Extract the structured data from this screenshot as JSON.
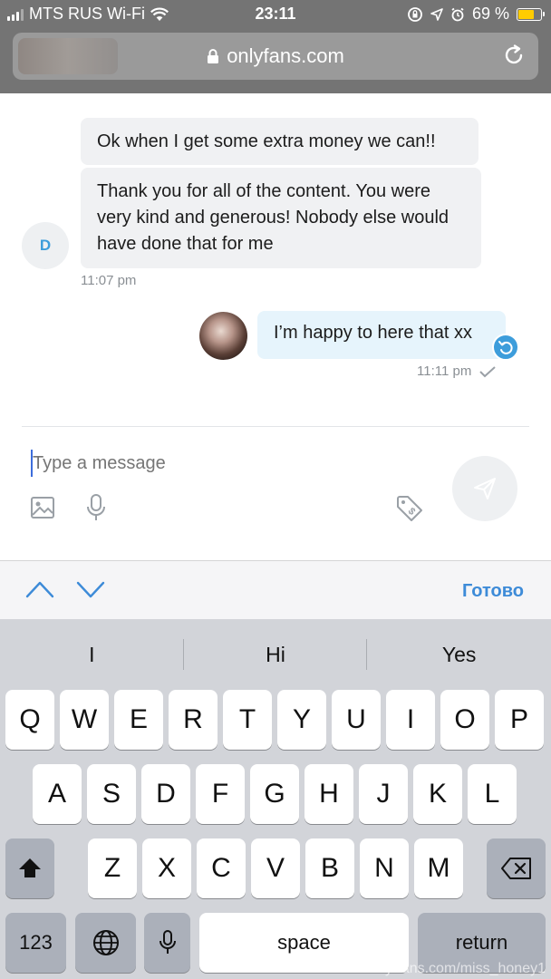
{
  "status_bar": {
    "carrier": "MTS RUS Wi-Fi",
    "time": "23:11",
    "battery_percent": "69 %"
  },
  "browser": {
    "url": "onlyfans.com"
  },
  "chat": {
    "contact_initial": "D",
    "messages": [
      {
        "text": "Ok when I get some extra money we can!!"
      },
      {
        "text": "Thank you for all of the content. You were very kind and generous! Nobody else would have done that for me"
      }
    ],
    "incoming_time": "11:07 pm",
    "outgoing": {
      "text": "I’m happy to here that xx",
      "time": "11:11 pm"
    }
  },
  "composer": {
    "placeholder": "Type a message"
  },
  "accessory_bar": {
    "done_label": "Готово"
  },
  "keyboard": {
    "suggestions": [
      "I",
      "Hi",
      "Yes"
    ],
    "row1": [
      "Q",
      "W",
      "E",
      "R",
      "T",
      "Y",
      "U",
      "I",
      "O",
      "P"
    ],
    "row2": [
      "A",
      "S",
      "D",
      "F",
      "G",
      "H",
      "J",
      "K",
      "L"
    ],
    "row3": [
      "Z",
      "X",
      "C",
      "V",
      "B",
      "N",
      "M"
    ],
    "numbers_label": "123",
    "space_label": "space",
    "return_label": "return"
  },
  "watermark": "OnlyFans.com/miss_honey1"
}
